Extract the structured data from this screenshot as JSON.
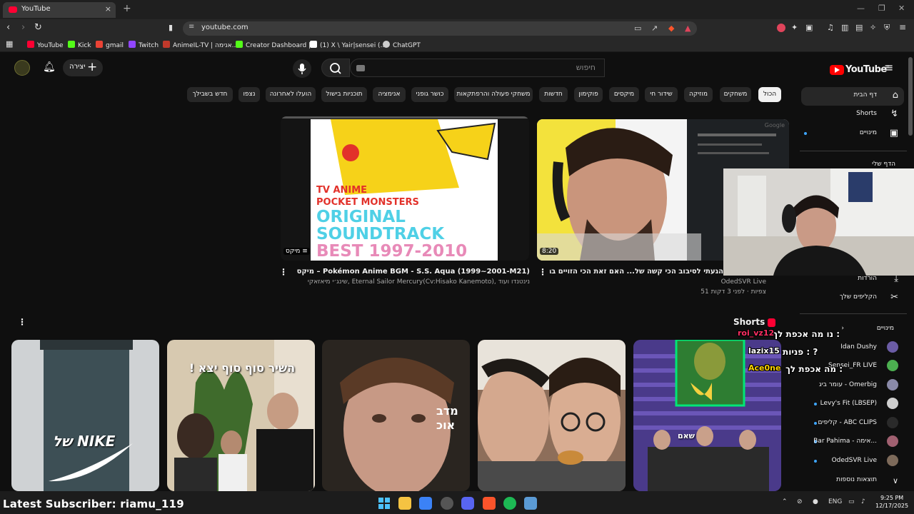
{
  "browser": {
    "tab_title": "YouTube",
    "tab_close": "×",
    "new_tab": "+",
    "url": "youtube.com",
    "bookmarks": [
      {
        "label": "YouTube",
        "color": "#ff0033"
      },
      {
        "label": "Kick",
        "color": "#53fc18"
      },
      {
        "label": "gmail",
        "color": "#ea4335"
      },
      {
        "label": "Twitch",
        "color": "#9146ff"
      },
      {
        "label": "AnimeIL-TV | אנימה...",
        "color": "#c0392b"
      },
      {
        "label": "Creator Dashboard |...",
        "color": "#53fc18"
      },
      {
        "label": "(1) X \\ Yair|sensei (...",
        "color": "#ffffff"
      },
      {
        "label": "ChatGPT",
        "color": "#cccccc"
      }
    ]
  },
  "yt": {
    "logo_text": "YouTube",
    "logo_cc": "IL",
    "search_placeholder": "חיפוש",
    "create_label": "יצירה",
    "chips": [
      {
        "label": "הכול",
        "active": true
      },
      {
        "label": "משחקים"
      },
      {
        "label": "מוזיקה"
      },
      {
        "label": "שידור חי"
      },
      {
        "label": "מיקסים"
      },
      {
        "label": "פוקימון"
      },
      {
        "label": "חדשות"
      },
      {
        "label": "משחקי פעולה והרפתקאות"
      },
      {
        "label": "כושר גופני"
      },
      {
        "label": "אנימציה"
      },
      {
        "label": "תוכניות בישול"
      },
      {
        "label": "הועלו לאחרונה"
      },
      {
        "label": "נצפו"
      },
      {
        "label": "חדש בשבילך"
      }
    ],
    "sidebar": {
      "home": "דף הבית",
      "shorts": "Shorts",
      "subscriptions": "מינויים",
      "you": "הדף שלי",
      "downloads": "הורדות",
      "clips": "הקליפים שלך",
      "subs_header": "מינויים",
      "channels": [
        {
          "name": "Idan Dushy",
          "dot": false,
          "color": "#6b5ca5"
        },
        {
          "name": "Sensei_FR LIVE",
          "dot": false,
          "color": "#4caf50"
        },
        {
          "name": "עומר ביג - Omerbig",
          "dot": false,
          "color": "#8a8aa8"
        },
        {
          "name": "Levy's Fit (LBSEP)",
          "dot": true,
          "color": "#cfcfcf"
        },
        {
          "name": "קליפים - ABC CLIPS",
          "dot": true,
          "color": "#2a2a2a"
        },
        {
          "name": "Bar Pahima - אימה...",
          "dot": true,
          "color": "#a06070"
        },
        {
          "name": "OdedSVR Live",
          "dot": true,
          "color": "#7d6a5a"
        }
      ],
      "show_more": "תוצאות נוספות"
    },
    "videos": [
      {
        "title": "מיקס – Pokémon Anime BGM - S.S. Aqua (1999~2001-M21)",
        "meta": "שינג׳י מיאזאקי, Eternal Sailor Mercury(Cv:Hisako Kanemoto), נינטנדו ועוד",
        "badge": "מיקס",
        "art_lines": [
          "TV ANIME",
          "POCKET MONSTERS",
          "ORIGINAL",
          "SOUNDTRACK",
          "BEST 1997-2010"
        ]
      },
      {
        "title": "הגעתי לסיבוב הכי קשה של... האם זאת הכי הזויים בגוגל?",
        "channel": "OdedSVR Live",
        "meta": "51 צפיות · לפני 3 דקות",
        "duration": "8:20",
        "corner_label": "Google"
      }
    ],
    "shorts_header": "Shorts",
    "shorts": [
      {
        "overlay": "של NIKE",
        "bg": "#cfd2d4"
      },
      {
        "overlay": "השיר סוף סוף יצא !",
        "bg": "#d7c9b0"
      },
      {
        "overlay": "מדב\nאוכ",
        "bg": "#2a2520"
      },
      {
        "overlay": "",
        "bg": "#8d6e5a"
      },
      {
        "overlay": "שאם",
        "bg": "#3b2d74"
      }
    ]
  },
  "stream": {
    "chat": [
      {
        "user": "roi_vz12",
        "msg": "נו מה אכפת לך :",
        "color": "#ff2e63"
      },
      {
        "user": "lazix15",
        "msg": "פניות : ?",
        "color": "#ffffff"
      },
      {
        "user": "Ace0ne",
        "msg": "מה אכפת לך :",
        "color": "#ffd400"
      }
    ],
    "subscriber_alert": "Latest Subscriber: riamu_119"
  },
  "taskbar": {
    "lang": "ENG",
    "time": "9:25 PM",
    "date": "12/17/2025"
  }
}
